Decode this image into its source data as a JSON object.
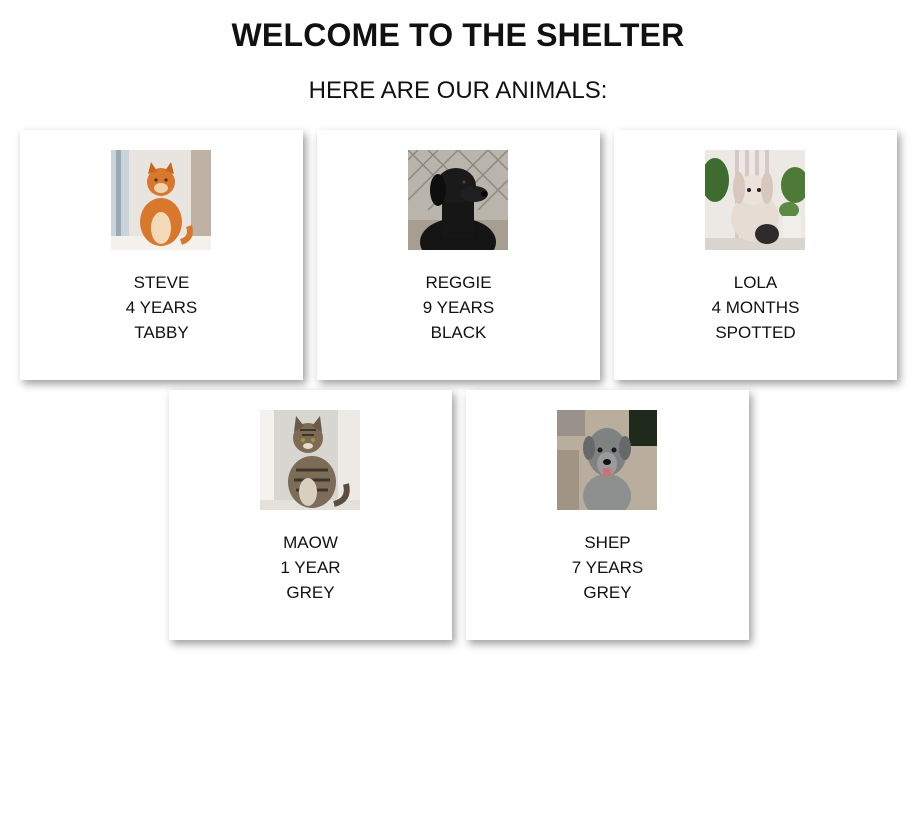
{
  "header": {
    "title": "WELCOME TO THE SHELTER",
    "subtitle": "HERE ARE OUR ANIMALS:"
  },
  "animals": [
    {
      "name": "STEVE",
      "age": "4 YEARS",
      "color": "TABBY",
      "photo": "orange-cat-photo"
    },
    {
      "name": "REGGIE",
      "age": "9 YEARS",
      "color": "BLACK",
      "photo": "black-dog-photo"
    },
    {
      "name": "LOLA",
      "age": "4 MONTHS",
      "color": "SPOTTED",
      "photo": "rabbit-photo"
    },
    {
      "name": "MAOW",
      "age": "1 YEAR",
      "color": "GREY",
      "photo": "tabby-cat-photo"
    },
    {
      "name": "SHEP",
      "age": "7 YEARS",
      "color": "GREY",
      "photo": "grey-dog-photo"
    }
  ]
}
